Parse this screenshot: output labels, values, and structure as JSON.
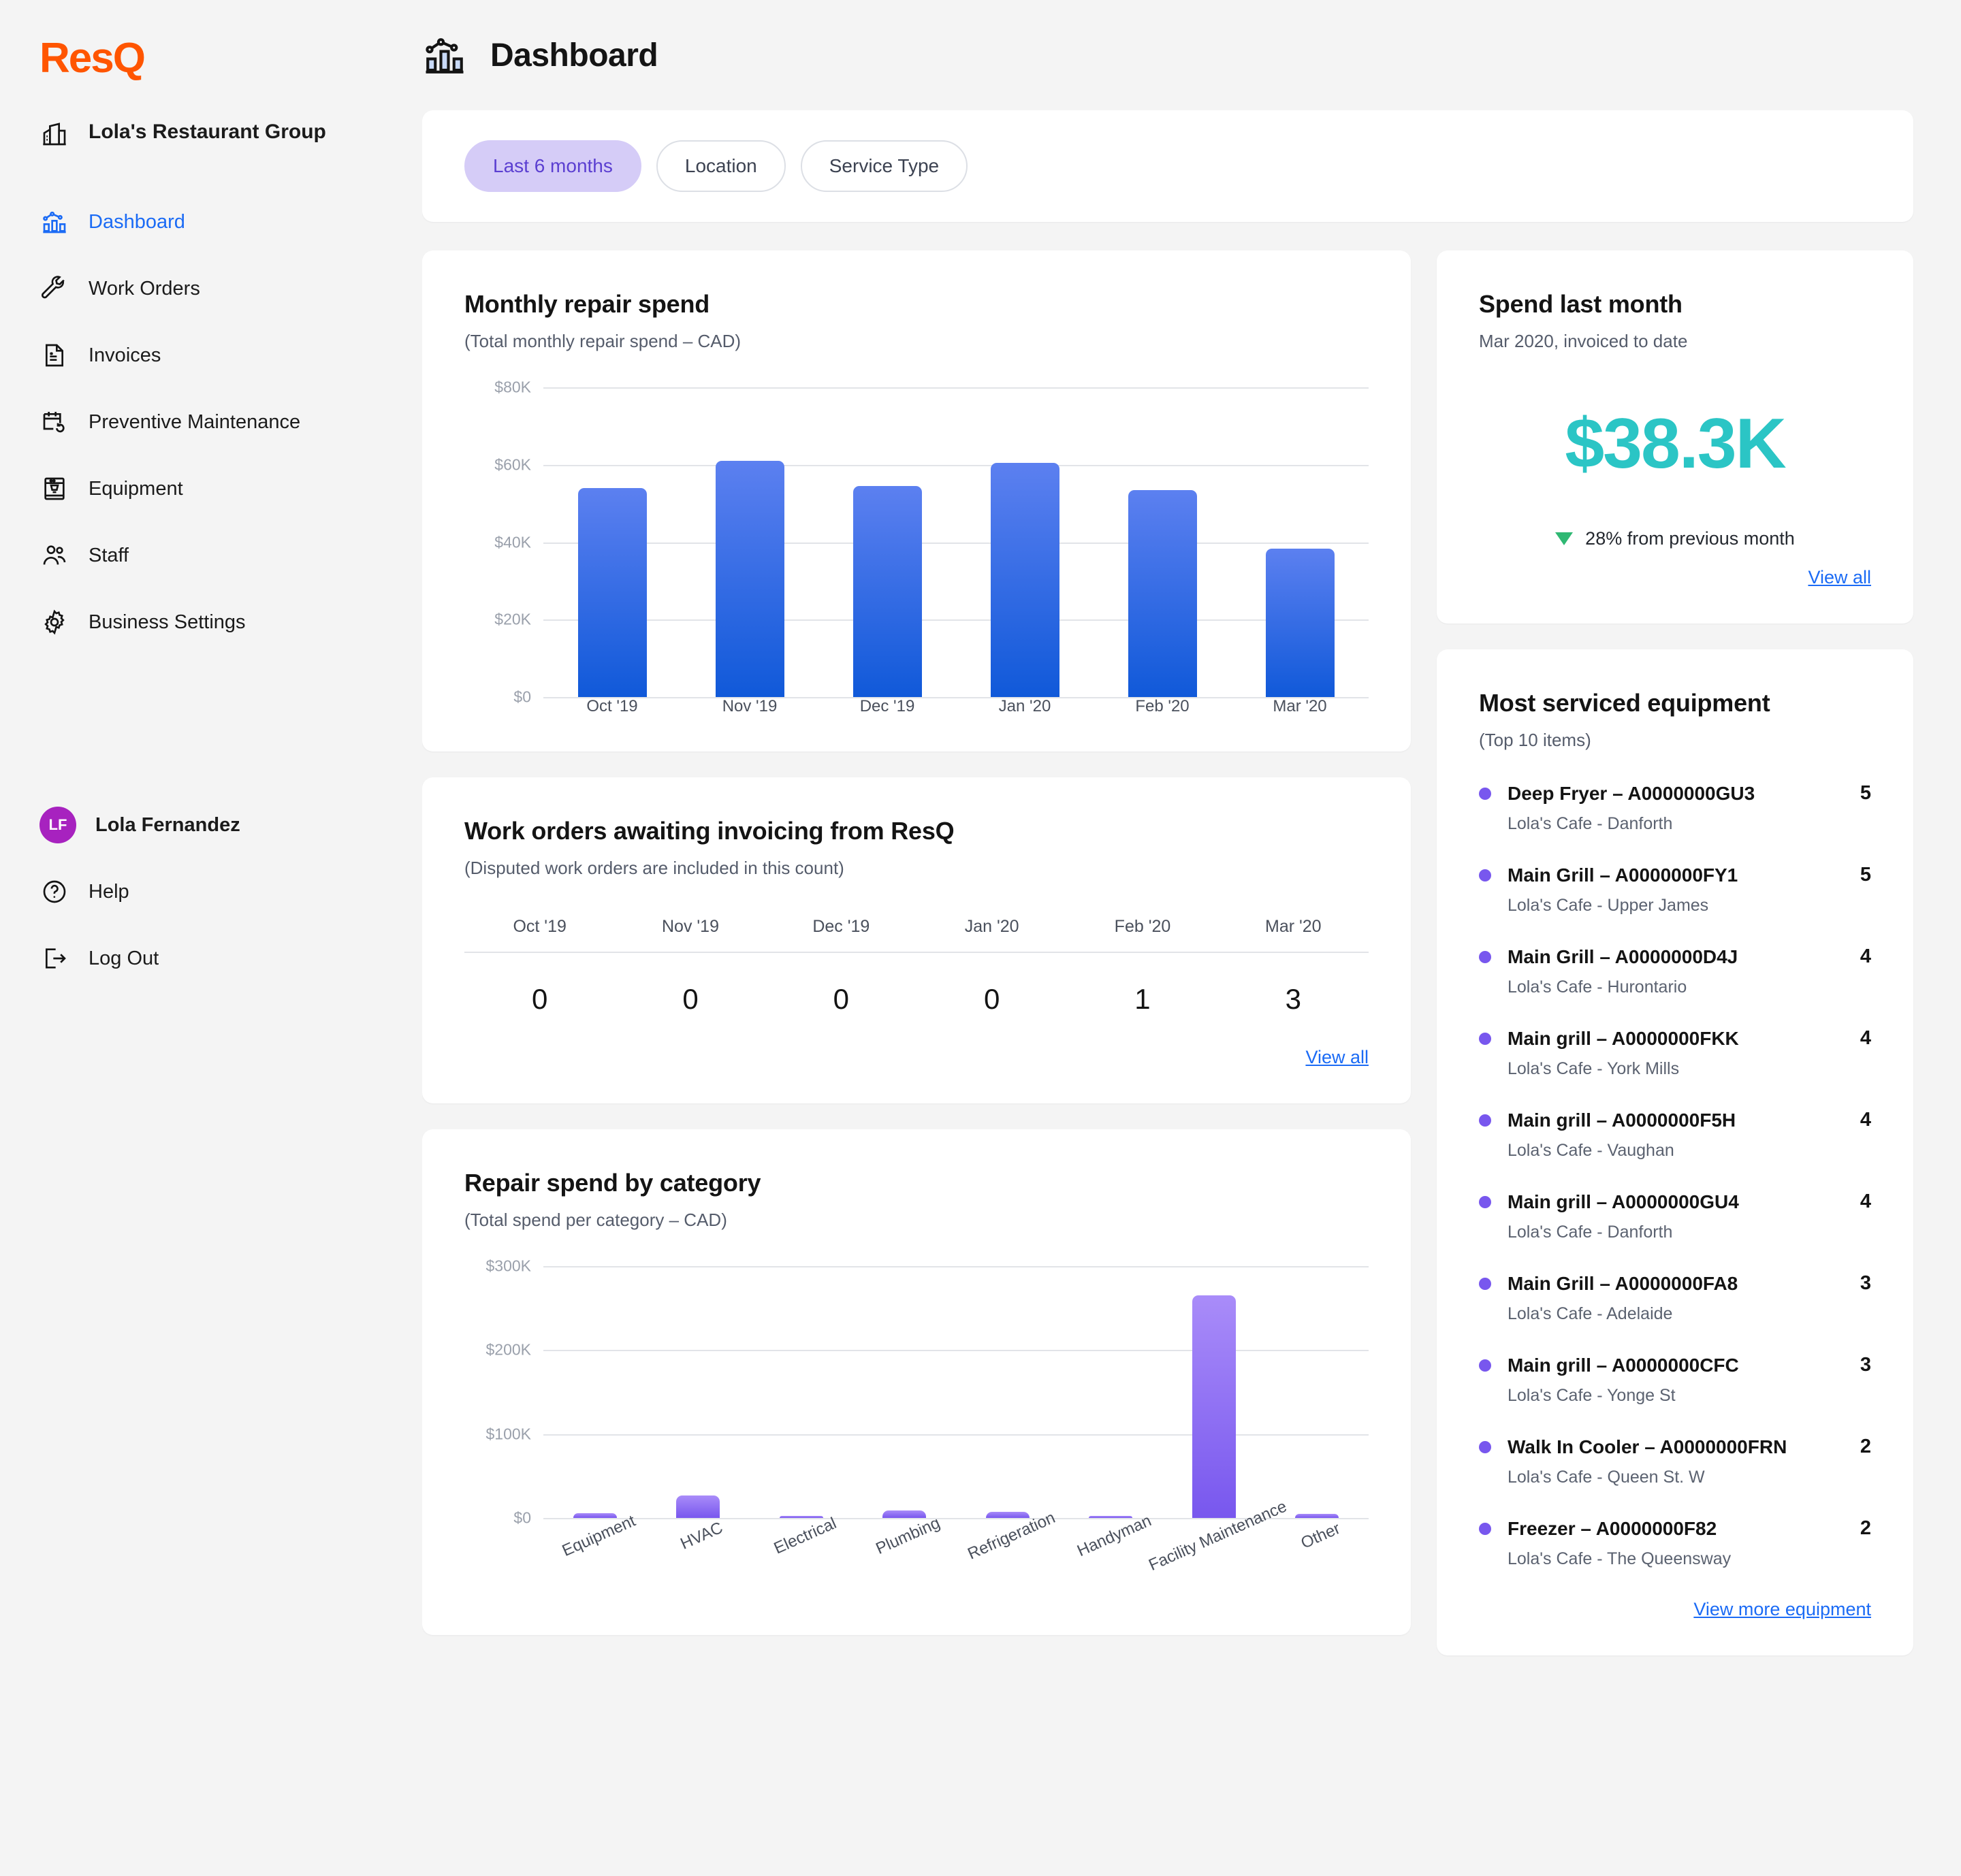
{
  "brand": {
    "name": "ResQ",
    "color": "#FF5500"
  },
  "sidebar": {
    "org_name": "Lola's Restaurant Group",
    "items": [
      {
        "label": "Dashboard",
        "icon": "chart-bar-icon",
        "active": true
      },
      {
        "label": "Work Orders",
        "icon": "wrench-icon",
        "active": false
      },
      {
        "label": "Invoices",
        "icon": "invoice-icon",
        "active": false
      },
      {
        "label": "Preventive Maintenance",
        "icon": "calendar-refresh-icon",
        "active": false
      },
      {
        "label": "Equipment",
        "icon": "espresso-machine-icon",
        "active": false
      },
      {
        "label": "Staff",
        "icon": "people-icon",
        "active": false
      },
      {
        "label": "Business Settings",
        "icon": "gear-icon",
        "active": false
      }
    ],
    "user": {
      "initials": "LF",
      "name": "Lola Fernandez",
      "avatar_color": "#A722BF"
    },
    "footer_items": [
      {
        "label": "Help",
        "icon": "question-circle-icon"
      },
      {
        "label": "Log Out",
        "icon": "logout-icon"
      }
    ]
  },
  "header": {
    "title": "Dashboard",
    "icon": "chart-bar-icon"
  },
  "filters": {
    "chips": [
      {
        "label": "Last 6 months",
        "selected": true
      },
      {
        "label": "Location",
        "selected": false
      },
      {
        "label": "Service Type",
        "selected": false
      }
    ],
    "selected_color": "#D5CCF7",
    "selected_text_color": "#5B3FD1"
  },
  "monthly_spend_card": {
    "title": "Monthly repair spend",
    "subtitle": "(Total monthly repair spend – CAD)"
  },
  "work_orders_card": {
    "title": "Work orders awaiting invoicing from ResQ",
    "subtitle": "(Disputed work orders are included in this count)",
    "columns": [
      "Oct '19",
      "Nov '19",
      "Dec '19",
      "Jan '20",
      "Feb '20",
      "Mar '20"
    ],
    "values": [
      "0",
      "0",
      "0",
      "0",
      "1",
      "3"
    ],
    "link_label": "View all"
  },
  "category_card": {
    "title": "Repair spend by category",
    "subtitle": "(Total spend per category – CAD)"
  },
  "spend_last_month_card": {
    "title": "Spend last month",
    "subtitle": "Mar 2020, invoiced to date",
    "amount": "$38.3K",
    "amount_color": "#2BC5C5",
    "delta_direction": "down",
    "delta_text": "28% from previous month",
    "delta_color": "#2FB873",
    "link_label": "View all"
  },
  "equipment_card": {
    "title": "Most serviced equipment",
    "subtitle": "(Top 10 items)",
    "link_label": "View more equipment",
    "dot_color": "#7857EE",
    "items": [
      {
        "name": "Deep Fryer – A0000000GU3",
        "location": "Lola's Cafe - Danforth",
        "count": "5"
      },
      {
        "name": "Main Grill – A0000000FY1",
        "location": "Lola's Cafe - Upper James",
        "count": "5"
      },
      {
        "name": "Main Grill – A0000000D4J",
        "location": "Lola's Cafe - Hurontario",
        "count": "4"
      },
      {
        "name": "Main grill – A0000000FKK",
        "location": "Lola's Cafe - York Mills",
        "count": "4"
      },
      {
        "name": "Main grill – A0000000F5H",
        "location": "Lola's Cafe - Vaughan",
        "count": "4"
      },
      {
        "name": "Main grill – A0000000GU4",
        "location": "Lola's Cafe - Danforth",
        "count": "4"
      },
      {
        "name": "Main Grill – A0000000FA8",
        "location": "Lola's Cafe - Adelaide",
        "count": "3"
      },
      {
        "name": "Main grill – A0000000CFC",
        "location": "Lola's Cafe - Yonge St",
        "count": "3"
      },
      {
        "name": "Walk In Cooler – A0000000FRN",
        "location": "Lola's Cafe - Queen St. W",
        "count": "2"
      },
      {
        "name": "Freezer – A0000000F82",
        "location": "Lola's Cafe - The Queensway",
        "count": "2"
      }
    ]
  },
  "chart_data": [
    {
      "id": "monthly_repair_spend",
      "type": "bar",
      "title": "Monthly repair spend",
      "subtitle": "(Total monthly repair spend – CAD)",
      "xlabel": "",
      "ylabel": "",
      "categories": [
        "Oct '19",
        "Nov '19",
        "Dec '19",
        "Jan '20",
        "Feb '20",
        "Mar '20"
      ],
      "values": [
        54000,
        61000,
        54500,
        60500,
        53500,
        38300
      ],
      "ylim": [
        0,
        80000
      ],
      "yticks": [
        0,
        20000,
        40000,
        60000,
        80000
      ],
      "ytick_labels": [
        "$0",
        "$20K",
        "$40K",
        "$60K",
        "$80K"
      ],
      "grid": true,
      "legend": false,
      "bar_gradient": [
        "#5C80F0",
        "#1059D9"
      ]
    },
    {
      "id": "repair_spend_by_category",
      "type": "bar",
      "title": "Repair spend by category",
      "subtitle": "(Total spend per category – CAD)",
      "xlabel": "",
      "ylabel": "",
      "categories": [
        "Equipment",
        "HVAC",
        "Electrical",
        "Plumbing",
        "Refrigeration",
        "Handyman",
        "Facility Maintenance",
        "Other"
      ],
      "values": [
        6000,
        27000,
        2500,
        9000,
        7000,
        2500,
        265000,
        5000
      ],
      "ylim": [
        0,
        300000
      ],
      "yticks": [
        0,
        100000,
        200000,
        300000
      ],
      "ytick_labels": [
        "$0",
        "$100K",
        "$200K",
        "$300K"
      ],
      "grid": true,
      "legend": false,
      "bar_gradient": [
        "#A98CF9",
        "#7857EE"
      ]
    }
  ]
}
